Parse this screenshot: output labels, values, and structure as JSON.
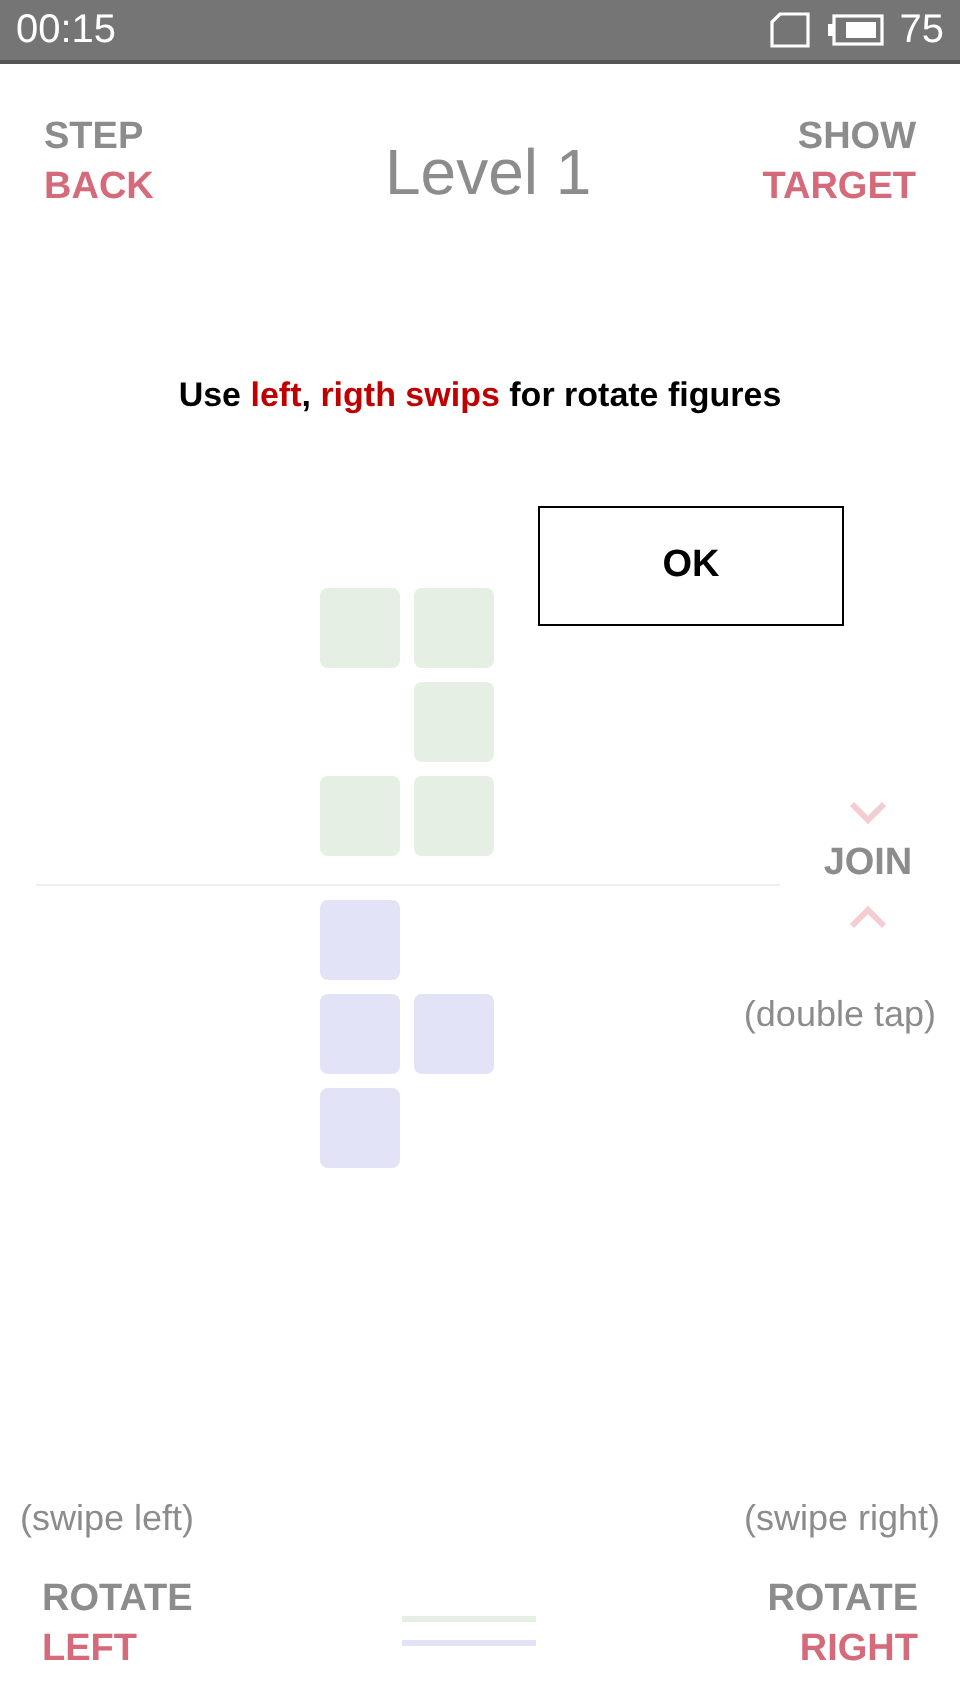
{
  "status_bar": {
    "time": "00:15",
    "battery": "75"
  },
  "header": {
    "step_back": [
      {
        "text": "STEP",
        "kind": "plain"
      },
      {
        "text": "BACK",
        "kind": "accent"
      }
    ],
    "title": "Level 1",
    "show_target": [
      {
        "text": "SHOW",
        "kind": "plain"
      },
      {
        "text": "TARGET",
        "kind": "accent"
      }
    ]
  },
  "hint": {
    "segments": [
      {
        "text": "Use ",
        "kind": "plain"
      },
      {
        "text": "left",
        "kind": "accent"
      },
      {
        "text": ", ",
        "kind": "plain"
      },
      {
        "text": "rigth swips",
        "kind": "accent"
      },
      {
        "text": " for rotate figures",
        "kind": "plain"
      }
    ],
    "button": "OK"
  },
  "figures": [
    {
      "color": "#e6efe4",
      "rows": [
        {
          "kind": "full"
        },
        {
          "kind": "right"
        },
        {
          "kind": "full"
        }
      ]
    },
    {
      "color": "#e3e3f7",
      "rows": [
        {
          "kind": "left"
        },
        {
          "kind": "full"
        },
        {
          "kind": "left"
        }
      ]
    }
  ],
  "join": {
    "label": "JOIN",
    "hint": "(double tap)"
  },
  "rotate_left": {
    "hint": "(swipe left)",
    "lines": [
      {
        "text": "ROTATE",
        "kind": "plain"
      },
      {
        "text": "LEFT",
        "kind": "accent"
      }
    ]
  },
  "rotate_right": {
    "hint": "(swipe right)",
    "lines": [
      {
        "text": "ROTATE",
        "kind": "plain"
      },
      {
        "text": "RIGHT",
        "kind": "accent"
      }
    ]
  }
}
